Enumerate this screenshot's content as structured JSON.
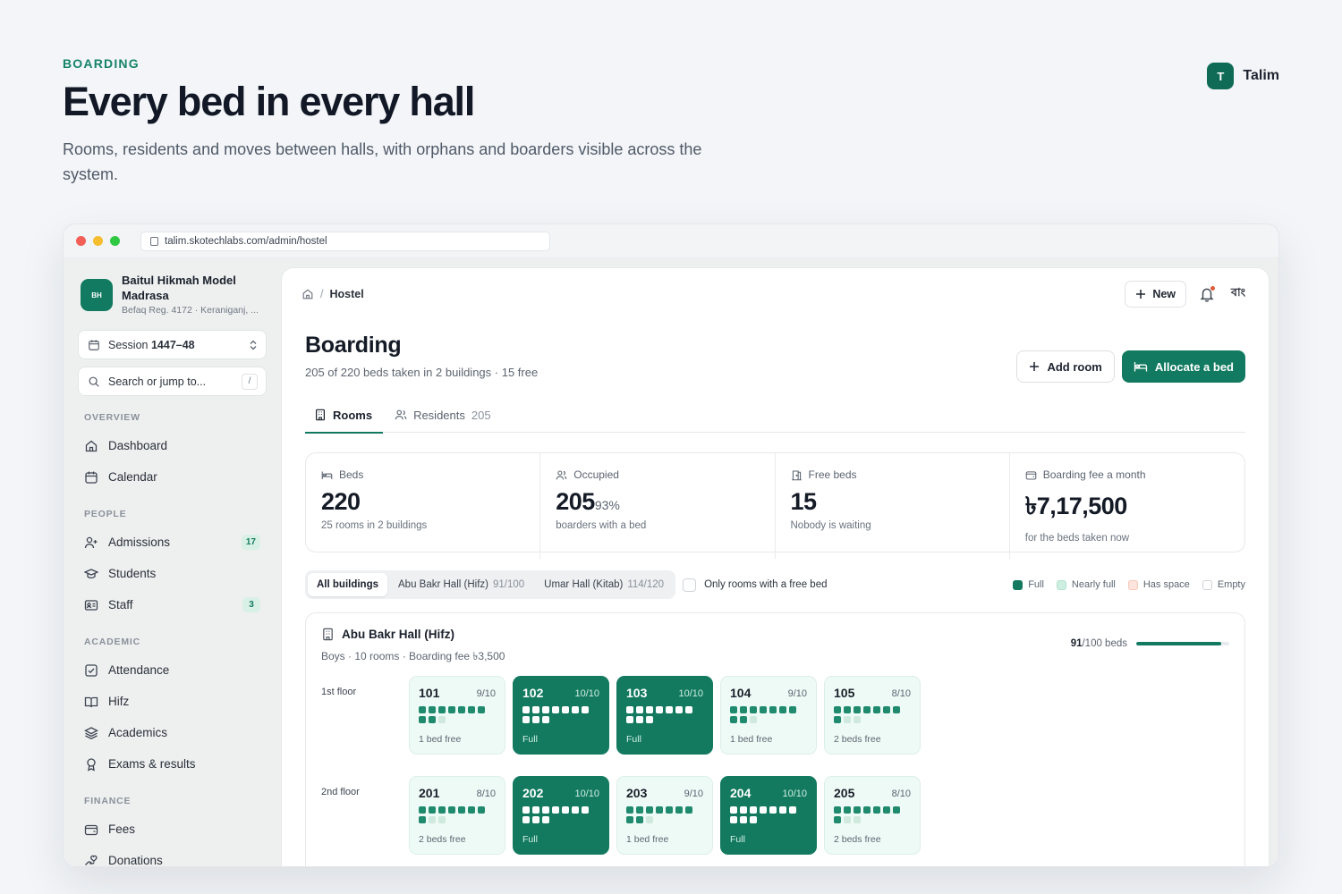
{
  "page": {
    "eyebrow": "BOARDING",
    "title": "Every bed in every hall",
    "subtitle": "Rooms, residents and moves between halls, with orphans and boarders visible across the system.",
    "user": {
      "initial": "T",
      "name": "Talim"
    }
  },
  "browser": {
    "url": "talim.skotechlabs.com/admin/hostel"
  },
  "sidebar": {
    "logo_text": "BH",
    "org_name": "Baitul Hikmah Model Madrasa",
    "org_reg": "Befaq Reg. 4172 · Keraniganj, ...",
    "session_label": "Session",
    "session_value": "1447–48",
    "search_placeholder": "Search or jump to...",
    "search_shortcut": "/",
    "sections": {
      "overview": "OVERVIEW",
      "people": "PEOPLE",
      "academic": "ACADEMIC",
      "finance": "FINANCE"
    },
    "items": {
      "dashboard": "Dashboard",
      "calendar": "Calendar",
      "admissions": "Admissions",
      "admissions_badge": "17",
      "students": "Students",
      "staff": "Staff",
      "staff_badge": "3",
      "attendance": "Attendance",
      "hifz": "Hifz",
      "academics": "Academics",
      "exams": "Exams & results",
      "fees": "Fees",
      "donations": "Donations"
    }
  },
  "topbar": {
    "breadcrumb_current": "Hostel",
    "breadcrumb_sep": "/",
    "new_label": "New",
    "lang_label": "বাং"
  },
  "header": {
    "title": "Boarding",
    "subtitle": "205 of 220 beds taken in 2 buildings · 15 free",
    "add_room": "Add room",
    "allocate": "Allocate a bed"
  },
  "tabs": {
    "rooms": "Rooms",
    "residents": "Residents",
    "residents_count": "205"
  },
  "stats": {
    "beds": {
      "label": "Beds",
      "value": "220",
      "note": "25 rooms in 2 buildings"
    },
    "occupied": {
      "label": "Occupied",
      "value": "205",
      "pct": "93%",
      "note": "boarders with a bed"
    },
    "free": {
      "label": "Free beds",
      "value": "15",
      "note": "Nobody is waiting"
    },
    "fee": {
      "label": "Boarding fee a month",
      "value": "৳7,17,500",
      "note": "for the beds taken now"
    }
  },
  "filters": {
    "all": "All buildings",
    "abu_bakr": "Abu Bakr Hall (Hifz)",
    "abu_bakr_frac": "91/100",
    "umar": "Umar Hall (Kitab)",
    "umar_frac": "114/120",
    "only_free": "Only rooms with a free bed"
  },
  "legend": {
    "full": "Full",
    "nearly": "Nearly full",
    "space": "Has space",
    "empty": "Empty"
  },
  "colors": {
    "accent": "#117a60",
    "nearly_full": "#cdeee0",
    "has_space": "#fde4dc",
    "empty": "#ffffff"
  },
  "hall": {
    "name": "Abu Bakr Hall (Hifz)",
    "sub": "Boys · 10 rooms · Boarding fee ৳3,500",
    "taken": "91",
    "capacity_text": "/100 beds",
    "fill_fraction": 0.91,
    "floors": [
      {
        "label": "1st floor",
        "rooms": [
          {
            "no": "101",
            "occ": "9/10",
            "taken": 9,
            "total": 10,
            "status": "1 bed free",
            "full": false
          },
          {
            "no": "102",
            "occ": "10/10",
            "taken": 10,
            "total": 10,
            "status": "Full",
            "full": true
          },
          {
            "no": "103",
            "occ": "10/10",
            "taken": 10,
            "total": 10,
            "status": "Full",
            "full": true
          },
          {
            "no": "104",
            "occ": "9/10",
            "taken": 9,
            "total": 10,
            "status": "1 bed free",
            "full": false
          },
          {
            "no": "105",
            "occ": "8/10",
            "taken": 8,
            "total": 10,
            "status": "2 beds free",
            "full": false
          }
        ]
      },
      {
        "label": "2nd floor",
        "rooms": [
          {
            "no": "201",
            "occ": "8/10",
            "taken": 8,
            "total": 10,
            "status": "2 beds free",
            "full": false
          },
          {
            "no": "202",
            "occ": "10/10",
            "taken": 10,
            "total": 10,
            "status": "Full",
            "full": true
          },
          {
            "no": "203",
            "occ": "9/10",
            "taken": 9,
            "total": 10,
            "status": "1 bed free",
            "full": false
          },
          {
            "no": "204",
            "occ": "10/10",
            "taken": 10,
            "total": 10,
            "status": "Full",
            "full": true
          },
          {
            "no": "205",
            "occ": "8/10",
            "taken": 8,
            "total": 10,
            "status": "2 beds free",
            "full": false
          }
        ]
      }
    ]
  }
}
